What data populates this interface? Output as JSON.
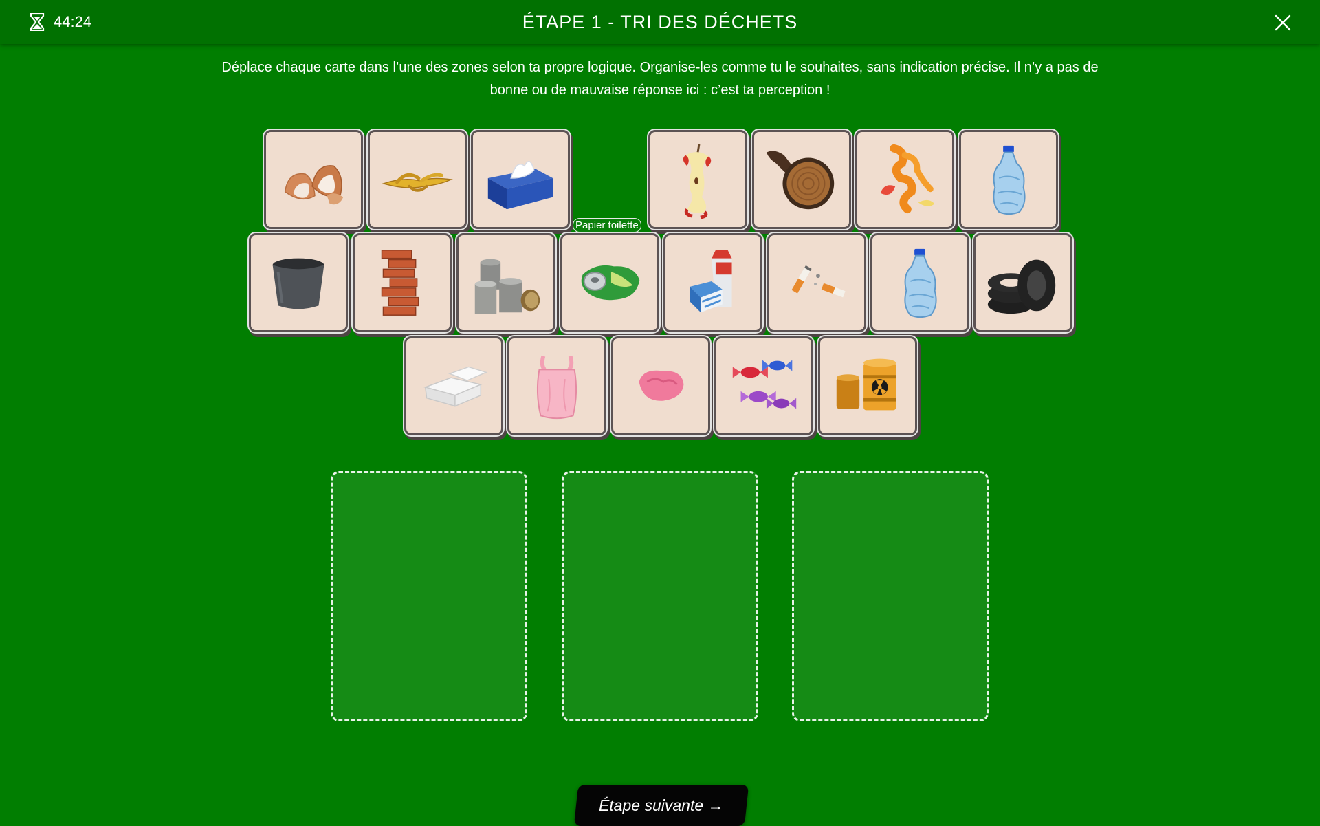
{
  "header": {
    "timer_icon": "hourglass-icon",
    "timer": "44:24",
    "title": "ÉTAPE 1 - TRI DES DÉCHETS",
    "close_icon": "close-icon"
  },
  "instructions": "Déplace chaque carte dans l’une des zones selon ta propre logique. Organise-les comme tu le souhaites, sans indication précise. Il n’y a pas de bonne ou de mauvaise réponse ici : c’est ta perception !",
  "cards": [
    {
      "icon": "eggshells-icon"
    },
    {
      "icon": "banana-peel-icon"
    },
    {
      "icon": "tissue-box-icon"
    },
    {
      "icon": "apple-core-icon"
    },
    {
      "icon": "wood-log-icon"
    },
    {
      "icon": "orange-peel-icon"
    },
    {
      "icon": "plastic-bottle-icon"
    },
    {
      "icon": "concrete-pot-icon"
    },
    {
      "icon": "bricks-icon"
    },
    {
      "icon": "tin-cans-icon"
    },
    {
      "icon": "crushed-soda-can-icon"
    },
    {
      "icon": "milk-cartons-icon"
    },
    {
      "icon": "cigarette-butts-icon"
    },
    {
      "icon": "plastic-bottle-icon"
    },
    {
      "icon": "tires-icon"
    },
    {
      "icon": "foam-food-box-icon"
    },
    {
      "icon": "plastic-bag-icon"
    },
    {
      "icon": "chewing-gum-icon"
    },
    {
      "icon": "candy-wrappers-icon"
    },
    {
      "icon": "toxic-barrels-icon"
    }
  ],
  "tooltip": "Papier toilette",
  "drop_zones": 3,
  "next_button": "Étape suivante →",
  "colors": {
    "background": "#017e01",
    "header": "#017101",
    "card": "#f0ddcf",
    "zone": "#158b15",
    "button": "#050505"
  }
}
